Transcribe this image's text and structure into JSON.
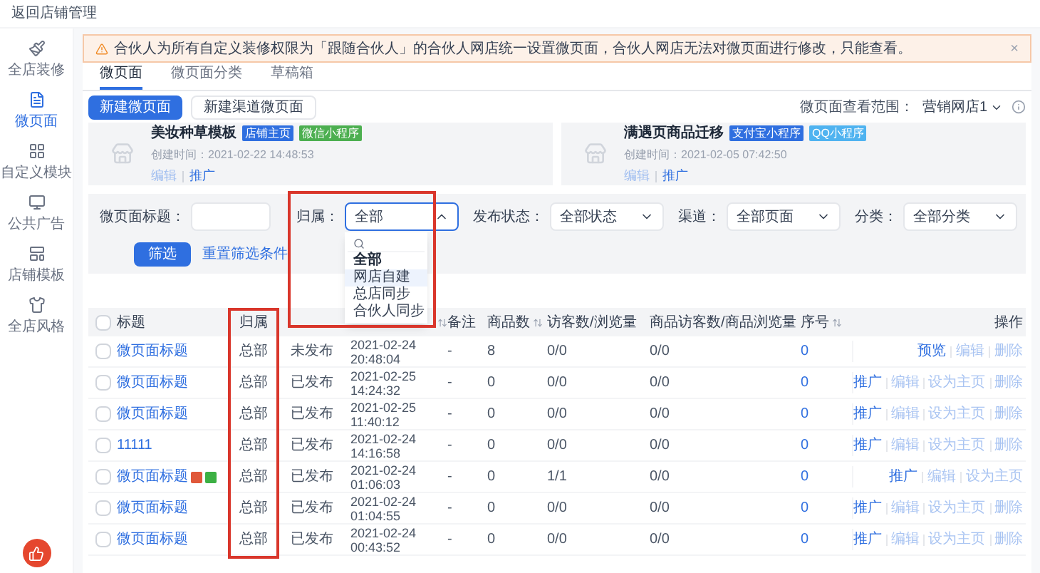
{
  "top_bar": {
    "back_link": "返回店铺管理"
  },
  "sidebar": {
    "items": [
      {
        "label": "全店装修",
        "selected": false
      },
      {
        "label": "微页面",
        "selected": true
      },
      {
        "label": "自定义模块",
        "selected": false
      },
      {
        "label": "公共广告",
        "selected": false
      },
      {
        "label": "店铺模板",
        "selected": false
      },
      {
        "label": "全店风格",
        "selected": false
      }
    ]
  },
  "alert": {
    "text": "合伙人为所有自定义装修权限为「跟随合伙人」的合伙人网店统一设置微页面，合伙人网店无法对微页面进行修改，只能查看。",
    "close": "×"
  },
  "tabs": [
    {
      "label": "微页面",
      "selected": true
    },
    {
      "label": "微页面分类",
      "selected": false
    },
    {
      "label": "草稿箱",
      "selected": false
    }
  ],
  "toolbar": {
    "buttons": [
      {
        "label": "新建微页面",
        "kind": "primary"
      },
      {
        "label": "新建渠道微页面",
        "kind": "default"
      }
    ],
    "scope_label": "微页面查看范围：",
    "scope_value": "营销网店1"
  },
  "cards": [
    {
      "title": "美妆种草模板",
      "tags": [
        {
          "label": "店铺主页",
          "color": "#2f6fe0"
        },
        {
          "label": "微信小程序",
          "color": "#4caf50"
        }
      ],
      "created": "创建时间：2021-02-22 14:48:53",
      "links": [
        {
          "label": "编辑",
          "disabled": true
        },
        {
          "label": "推广",
          "disabled": false
        }
      ]
    },
    {
      "title": "满遇页商品迁移",
      "tags": [
        {
          "label": "支付宝小程序",
          "color": "#2f6fe0"
        },
        {
          "label": "QQ小程序",
          "color": "#4fb3f0"
        }
      ],
      "created": "创建时间：2021-02-05 07:42:50",
      "links": [
        {
          "label": "编辑",
          "disabled": true
        },
        {
          "label": "推广",
          "disabled": false
        }
      ]
    }
  ],
  "filters": {
    "title_label": "微页面标题：",
    "selects": [
      {
        "label": "归属：",
        "value": "全部",
        "open": true
      },
      {
        "label": "发布状态：",
        "value": "全部状态",
        "open": false
      },
      {
        "label": "渠道：",
        "value": "全部页面",
        "open": false
      },
      {
        "label": "分类：",
        "value": "全部分类",
        "open": false
      }
    ],
    "filter_button": "筛选",
    "reset_link": "重置筛选条件"
  },
  "owner_dropdown": {
    "options": [
      {
        "label": "全部",
        "selected": true,
        "highlighted": false
      },
      {
        "label": "网店自建",
        "selected": false,
        "highlighted": true
      },
      {
        "label": "总店同步",
        "selected": false,
        "highlighted": false
      },
      {
        "label": "合伙人同步",
        "selected": false,
        "highlighted": false
      }
    ]
  },
  "table": {
    "header_checked": false,
    "columns": [
      {
        "label": "标题",
        "sortable": false
      },
      {
        "label": "归属",
        "sortable": false
      },
      {
        "sortable": true
      },
      {
        "label": "备注",
        "sortable": false
      },
      {
        "label": "商品数",
        "sortable": true
      },
      {
        "label": "访客数/浏览量",
        "sortable": false
      },
      {
        "label": "商品访客数/商品浏览量",
        "sortable": false
      },
      {
        "label": "序号",
        "sortable": true
      },
      {
        "label": "操作",
        "sortable": false
      }
    ],
    "rows": [
      {
        "checked": false,
        "title": "微页面标题",
        "marks": [],
        "owner": "总部",
        "status": "未发布",
        "date": "2021-02-24",
        "time": "20:48:04",
        "note": "-",
        "goods": "8",
        "visitors": "0/0",
        "goods_visitors": "0/0",
        "order": "0",
        "actions": [
          {
            "label": "预览",
            "disabled": false
          },
          {
            "label": "编辑",
            "disabled": true
          },
          {
            "label": "删除",
            "disabled": true
          }
        ]
      },
      {
        "checked": false,
        "title": "微页面标题",
        "marks": [],
        "owner": "总部",
        "status": "已发布",
        "date": "2021-02-25",
        "time": "14:24:32",
        "note": "-",
        "goods": "0",
        "visitors": "0/0",
        "goods_visitors": "0/0",
        "order": "0",
        "actions": [
          {
            "label": "推广",
            "disabled": false
          },
          {
            "label": "编辑",
            "disabled": true
          },
          {
            "label": "设为主页",
            "disabled": true
          },
          {
            "label": "删除",
            "disabled": true
          }
        ]
      },
      {
        "checked": false,
        "title": "微页面标题",
        "marks": [],
        "owner": "总部",
        "status": "已发布",
        "date": "2021-02-25",
        "time": "11:40:12",
        "note": "-",
        "goods": "0",
        "visitors": "0/0",
        "goods_visitors": "0/0",
        "order": "0",
        "actions": [
          {
            "label": "推广",
            "disabled": false
          },
          {
            "label": "编辑",
            "disabled": true
          },
          {
            "label": "设为主页",
            "disabled": true
          },
          {
            "label": "删除",
            "disabled": true
          }
        ]
      },
      {
        "checked": false,
        "title": "11111",
        "marks": [],
        "owner": "总部",
        "status": "已发布",
        "date": "2021-02-24",
        "time": "14:16:58",
        "note": "-",
        "goods": "0",
        "visitors": "0/0",
        "goods_visitors": "0/0",
        "order": "0",
        "actions": [
          {
            "label": "推广",
            "disabled": false
          },
          {
            "label": "编辑",
            "disabled": true
          },
          {
            "label": "设为主页",
            "disabled": true
          },
          {
            "label": "删除",
            "disabled": true
          }
        ]
      },
      {
        "checked": false,
        "title": "微页面标题",
        "marks": [
          {
            "color": "#e0583a"
          },
          {
            "color": "#3cb043"
          }
        ],
        "owner": "总部",
        "status": "已发布",
        "date": "2021-02-24",
        "time": "01:06:03",
        "note": "-",
        "goods": "0",
        "visitors": "1/1",
        "goods_visitors": "0/0",
        "order": "0",
        "actions": [
          {
            "label": "推广",
            "disabled": false
          },
          {
            "label": "编辑",
            "disabled": true
          },
          {
            "label": "设为主页",
            "disabled": true
          }
        ]
      },
      {
        "checked": false,
        "title": "微页面标题",
        "marks": [],
        "owner": "总部",
        "status": "已发布",
        "date": "2021-02-24",
        "time": "01:04:55",
        "note": "-",
        "goods": "0",
        "visitors": "0/0",
        "goods_visitors": "0/0",
        "order": "0",
        "actions": [
          {
            "label": "推广",
            "disabled": false
          },
          {
            "label": "编辑",
            "disabled": true
          },
          {
            "label": "设为主页",
            "disabled": true
          },
          {
            "label": "删除",
            "disabled": true
          }
        ]
      },
      {
        "checked": false,
        "title": "微页面标题",
        "marks": [],
        "owner": "总部",
        "status": "已发布",
        "date": "2021-02-24",
        "time": "00:43:52",
        "note": "-",
        "goods": "0",
        "visitors": "0/0",
        "goods_visitors": "0/0",
        "order": "0",
        "actions": [
          {
            "label": "推广",
            "disabled": false
          },
          {
            "label": "编辑",
            "disabled": true
          },
          {
            "label": "设为主页",
            "disabled": true
          },
          {
            "label": "删除",
            "disabled": true
          }
        ]
      }
    ]
  }
}
